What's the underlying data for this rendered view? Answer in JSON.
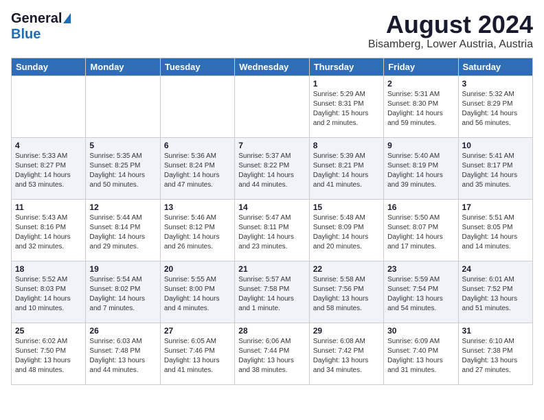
{
  "header": {
    "logo_general": "General",
    "logo_blue": "Blue",
    "month_title": "August 2024",
    "location": "Bisamberg, Lower Austria, Austria"
  },
  "weekdays": [
    "Sunday",
    "Monday",
    "Tuesday",
    "Wednesday",
    "Thursday",
    "Friday",
    "Saturday"
  ],
  "weeks": [
    [
      {
        "day": "",
        "info": ""
      },
      {
        "day": "",
        "info": ""
      },
      {
        "day": "",
        "info": ""
      },
      {
        "day": "",
        "info": ""
      },
      {
        "day": "1",
        "info": "Sunrise: 5:29 AM\nSunset: 8:31 PM\nDaylight: 15 hours\nand 2 minutes."
      },
      {
        "day": "2",
        "info": "Sunrise: 5:31 AM\nSunset: 8:30 PM\nDaylight: 14 hours\nand 59 minutes."
      },
      {
        "day": "3",
        "info": "Sunrise: 5:32 AM\nSunset: 8:29 PM\nDaylight: 14 hours\nand 56 minutes."
      }
    ],
    [
      {
        "day": "4",
        "info": "Sunrise: 5:33 AM\nSunset: 8:27 PM\nDaylight: 14 hours\nand 53 minutes."
      },
      {
        "day": "5",
        "info": "Sunrise: 5:35 AM\nSunset: 8:25 PM\nDaylight: 14 hours\nand 50 minutes."
      },
      {
        "day": "6",
        "info": "Sunrise: 5:36 AM\nSunset: 8:24 PM\nDaylight: 14 hours\nand 47 minutes."
      },
      {
        "day": "7",
        "info": "Sunrise: 5:37 AM\nSunset: 8:22 PM\nDaylight: 14 hours\nand 44 minutes."
      },
      {
        "day": "8",
        "info": "Sunrise: 5:39 AM\nSunset: 8:21 PM\nDaylight: 14 hours\nand 41 minutes."
      },
      {
        "day": "9",
        "info": "Sunrise: 5:40 AM\nSunset: 8:19 PM\nDaylight: 14 hours\nand 39 minutes."
      },
      {
        "day": "10",
        "info": "Sunrise: 5:41 AM\nSunset: 8:17 PM\nDaylight: 14 hours\nand 35 minutes."
      }
    ],
    [
      {
        "day": "11",
        "info": "Sunrise: 5:43 AM\nSunset: 8:16 PM\nDaylight: 14 hours\nand 32 minutes."
      },
      {
        "day": "12",
        "info": "Sunrise: 5:44 AM\nSunset: 8:14 PM\nDaylight: 14 hours\nand 29 minutes."
      },
      {
        "day": "13",
        "info": "Sunrise: 5:46 AM\nSunset: 8:12 PM\nDaylight: 14 hours\nand 26 minutes."
      },
      {
        "day": "14",
        "info": "Sunrise: 5:47 AM\nSunset: 8:11 PM\nDaylight: 14 hours\nand 23 minutes."
      },
      {
        "day": "15",
        "info": "Sunrise: 5:48 AM\nSunset: 8:09 PM\nDaylight: 14 hours\nand 20 minutes."
      },
      {
        "day": "16",
        "info": "Sunrise: 5:50 AM\nSunset: 8:07 PM\nDaylight: 14 hours\nand 17 minutes."
      },
      {
        "day": "17",
        "info": "Sunrise: 5:51 AM\nSunset: 8:05 PM\nDaylight: 14 hours\nand 14 minutes."
      }
    ],
    [
      {
        "day": "18",
        "info": "Sunrise: 5:52 AM\nSunset: 8:03 PM\nDaylight: 14 hours\nand 10 minutes."
      },
      {
        "day": "19",
        "info": "Sunrise: 5:54 AM\nSunset: 8:02 PM\nDaylight: 14 hours\nand 7 minutes."
      },
      {
        "day": "20",
        "info": "Sunrise: 5:55 AM\nSunset: 8:00 PM\nDaylight: 14 hours\nand 4 minutes."
      },
      {
        "day": "21",
        "info": "Sunrise: 5:57 AM\nSunset: 7:58 PM\nDaylight: 14 hours\nand 1 minute."
      },
      {
        "day": "22",
        "info": "Sunrise: 5:58 AM\nSunset: 7:56 PM\nDaylight: 13 hours\nand 58 minutes."
      },
      {
        "day": "23",
        "info": "Sunrise: 5:59 AM\nSunset: 7:54 PM\nDaylight: 13 hours\nand 54 minutes."
      },
      {
        "day": "24",
        "info": "Sunrise: 6:01 AM\nSunset: 7:52 PM\nDaylight: 13 hours\nand 51 minutes."
      }
    ],
    [
      {
        "day": "25",
        "info": "Sunrise: 6:02 AM\nSunset: 7:50 PM\nDaylight: 13 hours\nand 48 minutes."
      },
      {
        "day": "26",
        "info": "Sunrise: 6:03 AM\nSunset: 7:48 PM\nDaylight: 13 hours\nand 44 minutes."
      },
      {
        "day": "27",
        "info": "Sunrise: 6:05 AM\nSunset: 7:46 PM\nDaylight: 13 hours\nand 41 minutes."
      },
      {
        "day": "28",
        "info": "Sunrise: 6:06 AM\nSunset: 7:44 PM\nDaylight: 13 hours\nand 38 minutes."
      },
      {
        "day": "29",
        "info": "Sunrise: 6:08 AM\nSunset: 7:42 PM\nDaylight: 13 hours\nand 34 minutes."
      },
      {
        "day": "30",
        "info": "Sunrise: 6:09 AM\nSunset: 7:40 PM\nDaylight: 13 hours\nand 31 minutes."
      },
      {
        "day": "31",
        "info": "Sunrise: 6:10 AM\nSunset: 7:38 PM\nDaylight: 13 hours\nand 27 minutes."
      }
    ]
  ]
}
